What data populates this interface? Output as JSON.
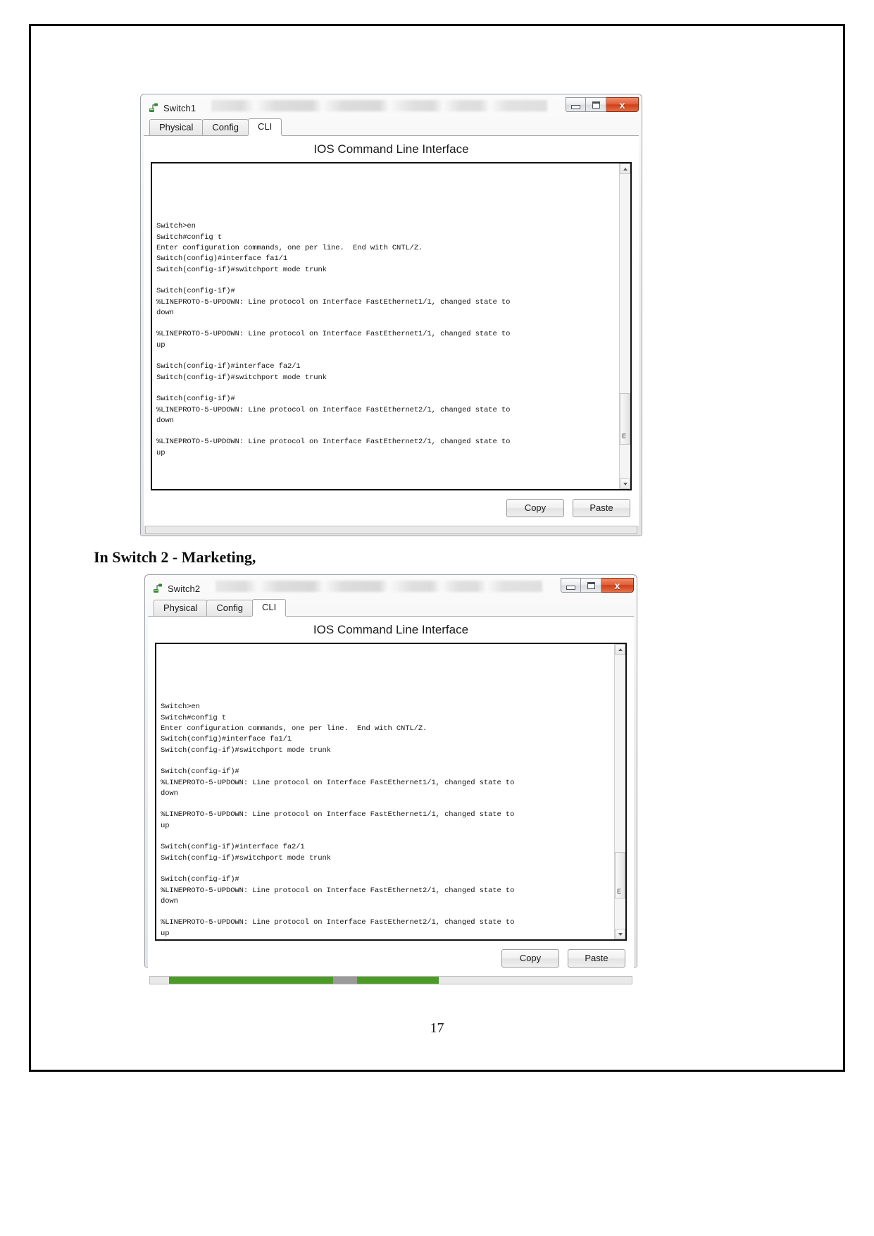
{
  "document": {
    "caption_switch2": "In Switch 2 - Marketing,",
    "page_number": "17"
  },
  "window1": {
    "title": "Switch1",
    "icon": "packet-tracer-device-icon",
    "controls": {
      "minimize": "minimize-icon",
      "maximize": "maximize-icon",
      "close": "x"
    },
    "tabs": [
      {
        "label": "Physical",
        "active": false
      },
      {
        "label": "Config",
        "active": false
      },
      {
        "label": "CLI",
        "active": true
      }
    ],
    "cli_heading": "IOS Command Line Interface",
    "terminal_text": "\n\n\n\n\nSwitch>en\nSwitch#config t\nEnter configuration commands, one per line.  End with CNTL/Z.\nSwitch(config)#interface fa1/1\nSwitch(config-if)#switchport mode trunk\n\nSwitch(config-if)#\n%LINEPROTO-5-UPDOWN: Line protocol on Interface FastEthernet1/1, changed state to\ndown\n\n%LINEPROTO-5-UPDOWN: Line protocol on Interface FastEthernet1/1, changed state to\nup\n\nSwitch(config-if)#interface fa2/1\nSwitch(config-if)#switchport mode trunk\n\nSwitch(config-if)#\n%LINEPROTO-5-UPDOWN: Line protocol on Interface FastEthernet2/1, changed state to\ndown\n\n%LINEPROTO-5-UPDOWN: Line protocol on Interface FastEthernet2/1, changed state to\nup\n",
    "scrollbar_marker": "E",
    "buttons": {
      "copy": "Copy",
      "paste": "Paste"
    }
  },
  "window2": {
    "title": "Switch2",
    "icon": "packet-tracer-device-icon",
    "controls": {
      "minimize": "minimize-icon",
      "maximize": "maximize-icon",
      "close": "x"
    },
    "tabs": [
      {
        "label": "Physical",
        "active": false
      },
      {
        "label": "Config",
        "active": false
      },
      {
        "label": "CLI",
        "active": true
      }
    ],
    "cli_heading": "IOS Command Line Interface",
    "terminal_text": "\n\n\n\n\nSwitch>en\nSwitch#config t\nEnter configuration commands, one per line.  End with CNTL/Z.\nSwitch(config)#interface fa1/1\nSwitch(config-if)#switchport mode trunk\n\nSwitch(config-if)#\n%LINEPROTO-5-UPDOWN: Line protocol on Interface FastEthernet1/1, changed state to\ndown\n\n%LINEPROTO-5-UPDOWN: Line protocol on Interface FastEthernet1/1, changed state to\nup\n\nSwitch(config-if)#interface fa2/1\nSwitch(config-if)#switchport mode trunk\n\nSwitch(config-if)#\n%LINEPROTO-5-UPDOWN: Line protocol on Interface FastEthernet2/1, changed state to\ndown\n\n%LINEPROTO-5-UPDOWN: Line protocol on Interface FastEthernet2/1, changed state to\nup\n",
    "scrollbar_marker": "E",
    "buttons": {
      "copy": "Copy",
      "paste": "Paste"
    },
    "status_progress_color": "#4d9b27"
  },
  "colors": {
    "close_button": "#cf3f17",
    "progress_green": "#4d9b27",
    "window_chrome": "#e9ebec",
    "terminal_text": "#141414"
  }
}
